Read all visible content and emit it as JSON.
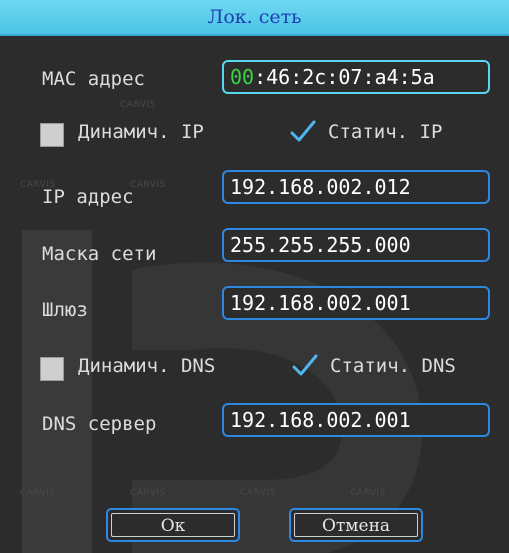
{
  "dialog": {
    "title": "Лок. сеть"
  },
  "mac": {
    "label": "MAC адрес",
    "value_prefix": "00",
    "value_rest": ":46:2c:07:a4:5a"
  },
  "ip_mode": {
    "dynamic_label": "Динамич. IP",
    "dynamic_checked": false,
    "static_label": "Статич. IP",
    "static_checked": true
  },
  "ip": {
    "label": "IP адрес",
    "value": "192.168.002.012"
  },
  "mask": {
    "label": "Маска сети",
    "value": "255.255.255.000"
  },
  "gateway": {
    "label": "Шлюз",
    "value": "192.168.002.001"
  },
  "dns_mode": {
    "dynamic_label": "Динамич. DNS",
    "dynamic_checked": false,
    "static_label": "Статич. DNS",
    "static_checked": true
  },
  "dns": {
    "label": "DNS сервер",
    "value": "192.168.002.001"
  },
  "buttons": {
    "ok": "Ок",
    "cancel": "Отмена"
  },
  "watermark_text": "CARVIS",
  "colors": {
    "title_bg": "#5ccde9",
    "title_text": "#1e3fb4",
    "field_border": "#2f88df",
    "field_border_active": "#57d8ee",
    "check_mark": "#4fb6ef",
    "mac_highlight": "#3cd146"
  }
}
